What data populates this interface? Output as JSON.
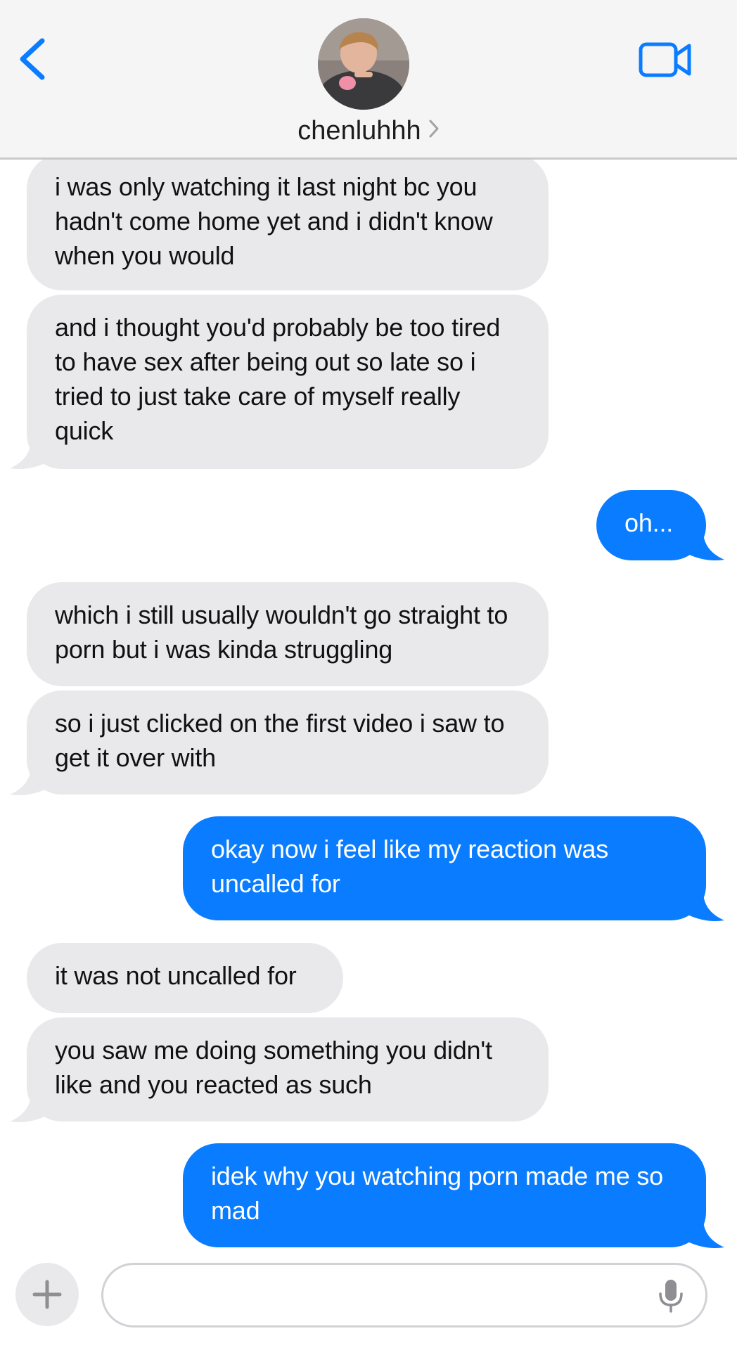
{
  "header": {
    "back_icon": "chevron-left-icon",
    "contact_name": "chenluhhh",
    "name_chevron_icon": "chevron-right-icon",
    "video_icon": "video-camera-icon",
    "accent_color": "#0a7cff"
  },
  "messages": [
    {
      "side": "in",
      "text": "i was only watching it last night bc you hadn't come home yet and i didn't know when you would"
    },
    {
      "side": "in",
      "text": "and i thought you'd probably be too tired to have sex after being out so late so i tried to just take care of myself really quick"
    },
    {
      "side": "out",
      "text": "oh..."
    },
    {
      "side": "in",
      "text": "which i still usually wouldn't go straight to porn but i was kinda struggling"
    },
    {
      "side": "in",
      "text": "so i just clicked on the first video i saw to get it over with"
    },
    {
      "side": "out",
      "text": "okay now i feel like my reaction was uncalled for"
    },
    {
      "side": "in",
      "text": "it was not uncalled for"
    },
    {
      "side": "in",
      "text": "you saw me doing something you didn't like and you reacted as such"
    },
    {
      "side": "out",
      "text": "idek why you watching porn made me so mad"
    }
  ],
  "composer": {
    "plus_icon": "plus-icon",
    "input_value": "",
    "mic_icon": "microphone-icon"
  },
  "colors": {
    "incoming_bubble": "#e9e9eb",
    "outgoing_bubble": "#0a7cff",
    "header_background": "#f5f5f5"
  }
}
